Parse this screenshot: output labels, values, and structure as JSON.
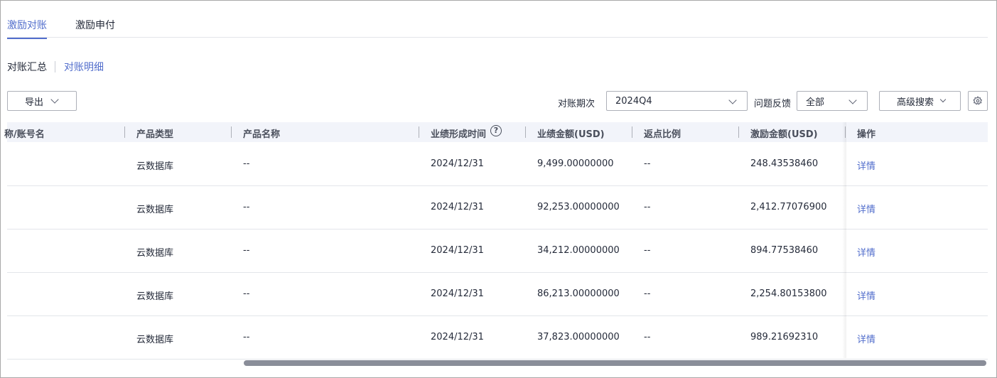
{
  "tabs": [
    {
      "label": "激励对账",
      "active": true
    },
    {
      "label": "激励申付",
      "active": false
    }
  ],
  "subtabs": [
    {
      "label": "对账汇总",
      "active": false
    },
    {
      "label": "对账明细",
      "active": true
    }
  ],
  "toolbar": {
    "export_label": "导出",
    "period_label": "对账期次",
    "period_value": "2024Q4",
    "feedback_label": "问题反馈",
    "feedback_value": "全部",
    "advanced_label": "高级搜索"
  },
  "table": {
    "columns": [
      "称/账号名",
      "产品类型",
      "产品名称",
      "业绩形成时间",
      "业绩金额(USD)",
      "返点比例",
      "激励金额(USD)",
      "操作"
    ],
    "help_glyph": "?",
    "rows": [
      {
        "account": "",
        "product_type": "云数据库",
        "product_name": "--",
        "date": "2024/12/31",
        "amount": "9,499.00000000",
        "ratio": "--",
        "incentive": "248.43538460",
        "action": "详情"
      },
      {
        "account": "",
        "product_type": "云数据库",
        "product_name": "--",
        "date": "2024/12/31",
        "amount": "92,253.00000000",
        "ratio": "--",
        "incentive": "2,412.77076900",
        "action": "详情"
      },
      {
        "account": "",
        "product_type": "云数据库",
        "product_name": "--",
        "date": "2024/12/31",
        "amount": "34,212.00000000",
        "ratio": "--",
        "incentive": "894.77538460",
        "action": "详情"
      },
      {
        "account": "",
        "product_type": "云数据库",
        "product_name": "--",
        "date": "2024/12/31",
        "amount": "86,213.00000000",
        "ratio": "--",
        "incentive": "2,254.80153800",
        "action": "详情"
      },
      {
        "account": "",
        "product_type": "云数据库",
        "product_name": "--",
        "date": "2024/12/31",
        "amount": "37,823.00000000",
        "ratio": "--",
        "incentive": "989.21692310",
        "action": "详情"
      }
    ]
  },
  "colors": {
    "accent": "#526ecc",
    "header_bg": "#f2f4fa",
    "border": "#adb0b8"
  }
}
